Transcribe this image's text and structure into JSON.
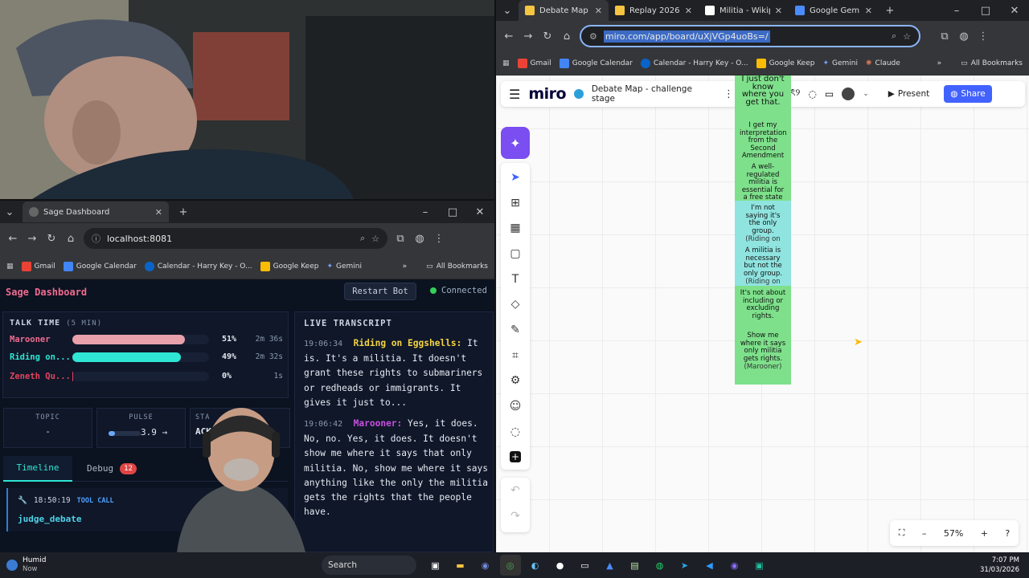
{
  "sage_browser": {
    "tab_title": "Sage Dashboard",
    "url": "localhost:8081",
    "bookmarks": [
      "Gmail",
      "Google Calendar",
      "Calendar - Harry Key - O...",
      "Google Keep",
      "Gemini"
    ],
    "all_bookmarks": "All Bookmarks"
  },
  "dashboard": {
    "title": "Sage Dashboard",
    "restart_label": "Restart Bot",
    "status": "Connected",
    "talk_time_title": "TALK TIME",
    "talk_time_window": "(5 MIN)",
    "speakers": [
      {
        "name": "Marooner",
        "percent": "51%",
        "pct_value": 0.51,
        "duration": "2m 36s",
        "color": "#f06b8f",
        "bar_color": "#e8a0ab"
      },
      {
        "name": "Riding on...",
        "percent": "49%",
        "pct_value": 0.49,
        "duration": "2m 32s",
        "color": "#2ee6d3",
        "bar_color": "#2ee6d3"
      },
      {
        "name": "Zeneth Qu...",
        "percent": "0%",
        "pct_value": 0.0,
        "duration": "1s",
        "color": "#e0445e",
        "bar_color": "#e0445e"
      }
    ],
    "topic_label": "TOPIC",
    "topic_value": "-",
    "pulse_label": "PULSE",
    "pulse_value": "3.9",
    "pulse_fill": 0.2,
    "status_label": "STA",
    "status_value": "ACK",
    "tabs": {
      "timeline": "Timeline",
      "debug": "Debug",
      "debug_count": "12"
    },
    "timeline_item": {
      "time": "18:50:19",
      "tag": "TOOL CALL",
      "name": "judge_debate"
    },
    "transcript_title": "LIVE TRANSCRIPT",
    "transcript": [
      {
        "time": "19:06:34",
        "speaker": "Riding on Eggshells:",
        "speaker_color": "#f5d442",
        "text": "It is. It's a militia. It doesn't grant these rights to submariners or redheads or immigrants. It gives it just to..."
      },
      {
        "time": "19:06:42",
        "speaker": "Marooner:",
        "speaker_color": "#c94fe0",
        "text": "Yes, it does. No, no. Yes, it does. It doesn't show me where it says that only militia. No, show me where it says anything like the only the militia gets the rights that the people have."
      }
    ]
  },
  "miro_browser": {
    "tabs": [
      {
        "title": "Debate Map - c",
        "active": true
      },
      {
        "title": "Replay 2026-03",
        "active": false
      },
      {
        "title": "Militia - Wikipe",
        "active": false
      },
      {
        "title": "Google Gemini",
        "active": false
      }
    ],
    "url": "miro.com/app/board/uXjVGp4uoBs=/",
    "bookmarks": [
      "Gmail",
      "Google Calendar",
      "Calendar - Harry Key - O...",
      "Google Keep",
      "Gemini",
      "Claude"
    ],
    "all_bookmarks": "All Bookmarks"
  },
  "miro": {
    "logo": "miro",
    "board_title": "Debate Map - challenge stage",
    "present_label": "Present",
    "share_label": "Share",
    "zoom": "57%",
    "stickies": [
      {
        "text": "I just don't know where you get that.",
        "color": "#7ee08b"
      },
      {
        "text": "I get my interpretation from the Second Amendment",
        "color": "#7ee08b"
      },
      {
        "text": "A well-regulated militia is essential for a free state",
        "color": "#7ee08b"
      },
      {
        "text": "I'm not saying it's the only group.",
        "sub": "(Riding on",
        "color": "#8fe4e0"
      },
      {
        "text": "A militia is necessary but not the only group.",
        "sub": "(Riding on",
        "color": "#8fe4e0"
      },
      {
        "text": "It's not about including or excluding rights.",
        "color": "#7ee08b"
      },
      {
        "text": "Show me where it says only militia gets rights.",
        "sub": "(Marooner)",
        "color": "#7ee08b"
      }
    ]
  },
  "taskbar": {
    "notif_title": "Humid",
    "notif_sub": "Now",
    "search": "Search",
    "time": "7:07 PM",
    "date": "31/03/2026"
  }
}
